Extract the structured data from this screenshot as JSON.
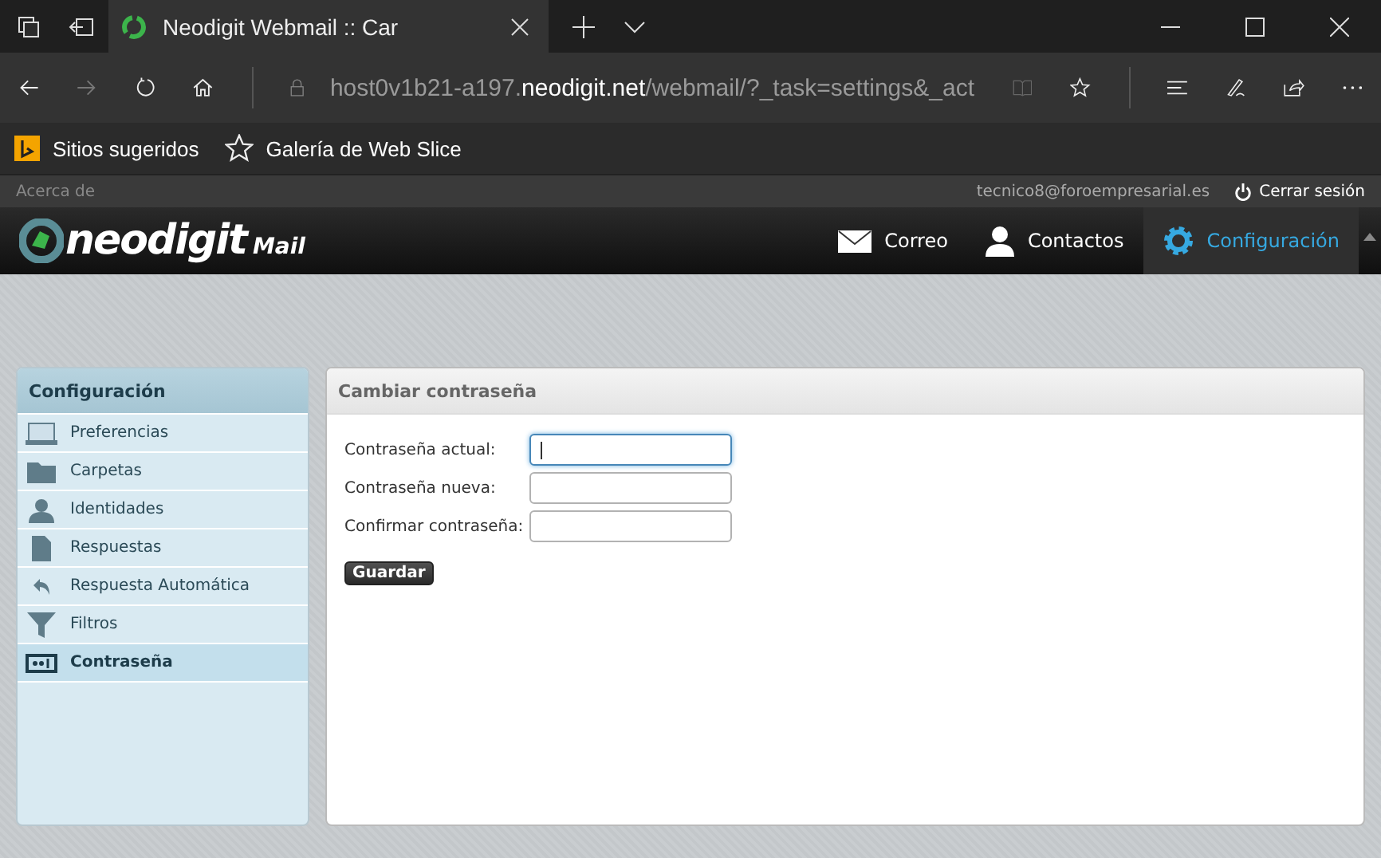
{
  "browser": {
    "tab": {
      "title": "Neodigit Webmail :: Car"
    },
    "address": {
      "host_prefix": "host0v1b21-a197.",
      "domain": "neodigit.net",
      "path": "/webmail/?_task=settings&_act"
    },
    "favorites": [
      {
        "label": "Sitios sugeridos",
        "kind": "bing"
      },
      {
        "label": "Galería de Web Slice",
        "kind": "star"
      }
    ]
  },
  "topbar": {
    "about": "Acerca de",
    "user": "tecnico8@foroempresarial.es",
    "logout": "Cerrar sesión"
  },
  "logo": {
    "name": "neodigit",
    "suffix": "Mail"
  },
  "nav": [
    {
      "label": "Correo",
      "kind": "mail",
      "selected": false
    },
    {
      "label": "Contactos",
      "kind": "contacts",
      "selected": false
    },
    {
      "label": "Configuración",
      "kind": "settings",
      "selected": true
    }
  ],
  "sidebar": {
    "title": "Configuración",
    "items": [
      {
        "label": "Preferencias",
        "kind": "laptop",
        "selected": false
      },
      {
        "label": "Carpetas",
        "kind": "folder",
        "selected": false
      },
      {
        "label": "Identidades",
        "kind": "person",
        "selected": false
      },
      {
        "label": "Respuestas",
        "kind": "document",
        "selected": false
      },
      {
        "label": "Respuesta Automática",
        "kind": "reply",
        "selected": false
      },
      {
        "label": "Filtros",
        "kind": "funnel",
        "selected": false
      },
      {
        "label": "Contraseña",
        "kind": "password",
        "selected": true
      }
    ]
  },
  "panel": {
    "title": "Cambiar contraseña",
    "fields": [
      {
        "label": "Contraseña actual:",
        "focused": true
      },
      {
        "label": "Contraseña nueva:",
        "focused": false
      },
      {
        "label": "Confirmar contraseña:",
        "focused": false
      }
    ],
    "button": "Guardar"
  }
}
